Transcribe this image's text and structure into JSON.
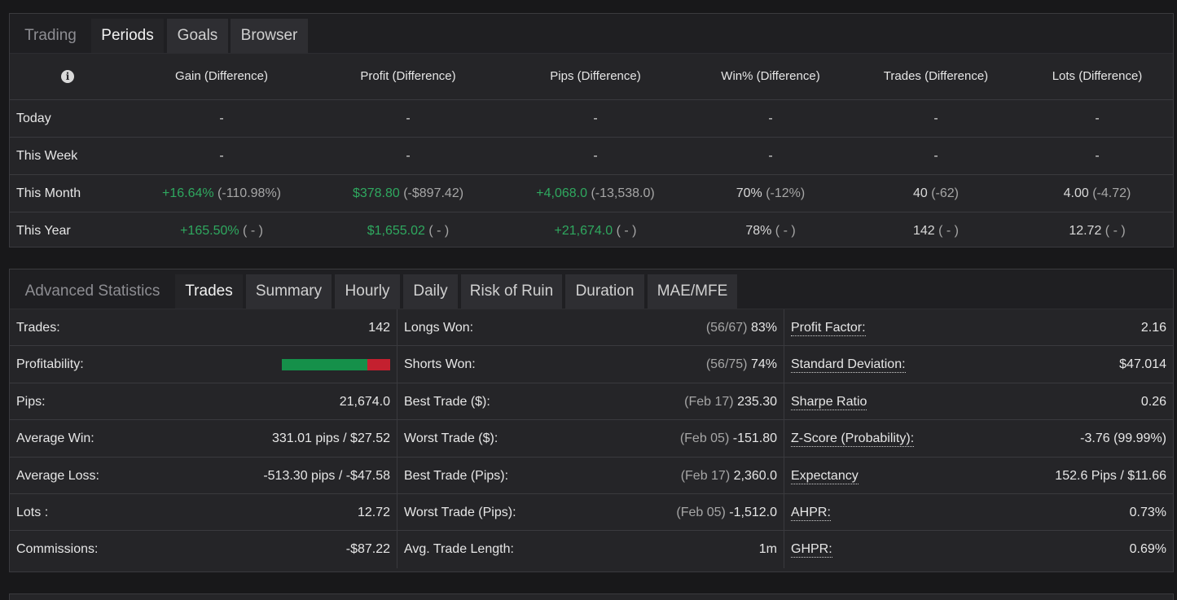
{
  "periods_tabs": [
    "Trading",
    "Periods",
    "Goals",
    "Browser"
  ],
  "periods": {
    "headers": [
      "Gain (Difference)",
      "Profit (Difference)",
      "Pips (Difference)",
      "Win% (Difference)",
      "Trades (Difference)",
      "Lots (Difference)"
    ],
    "rows": [
      {
        "label": "Today",
        "cells": [
          [
            "-",
            ""
          ],
          [
            "-",
            ""
          ],
          [
            "-",
            ""
          ],
          [
            "-",
            ""
          ],
          [
            "-",
            ""
          ],
          [
            "-",
            ""
          ]
        ]
      },
      {
        "label": "This Week",
        "cells": [
          [
            "-",
            ""
          ],
          [
            "-",
            ""
          ],
          [
            "-",
            ""
          ],
          [
            "-",
            ""
          ],
          [
            "-",
            ""
          ],
          [
            "-",
            ""
          ]
        ]
      },
      {
        "label": "This Month",
        "cells": [
          [
            "+16.64%",
            " (-110.98%)"
          ],
          [
            "$378.80",
            " (-$897.42)"
          ],
          [
            "+4,068.0",
            " (-13,538.0)"
          ],
          [
            "70%",
            " (-12%)"
          ],
          [
            "40",
            " (-62)"
          ],
          [
            "4.00",
            " (-4.72)"
          ]
        ]
      },
      {
        "label": "This Year",
        "cells": [
          [
            "+165.50%",
            " ( - )"
          ],
          [
            "$1,655.02",
            " ( - )"
          ],
          [
            "+21,674.0",
            " ( - )"
          ],
          [
            "78%",
            " ( - )"
          ],
          [
            "142",
            " ( - )"
          ],
          [
            "12.72",
            " ( - )"
          ]
        ]
      }
    ]
  },
  "adv_tabs": [
    "Advanced Statistics",
    "Trades",
    "Summary",
    "Hourly",
    "Daily",
    "Risk of Ruin",
    "Duration",
    "MAE/MFE"
  ],
  "adv": {
    "col1": [
      {
        "k": "Trades:",
        "v": "142"
      },
      {
        "k": "Profitability:",
        "v": ""
      },
      {
        "k": "Pips:",
        "v": "21,674.0"
      },
      {
        "k": "Average Win:",
        "v": "331.01 pips / $27.52"
      },
      {
        "k": "Average Loss:",
        "v": "-513.30 pips / -$47.58"
      },
      {
        "k": "Lots :",
        "v": "12.72"
      },
      {
        "k": "Commissions:",
        "v": "-$87.22"
      }
    ],
    "profitability_win_fraction": 0.79,
    "col2": [
      {
        "k": "Longs Won:",
        "m": "(56/67)",
        "v": "83%"
      },
      {
        "k": "Shorts Won:",
        "m": "(56/75)",
        "v": "74%"
      },
      {
        "k": "Best Trade ($):",
        "m": "(Feb 17)",
        "v": "235.30"
      },
      {
        "k": "Worst Trade ($):",
        "m": "(Feb 05)",
        "v": "-151.80"
      },
      {
        "k": "Best Trade (Pips):",
        "m": "(Feb 17)",
        "v": "2,360.0"
      },
      {
        "k": "Worst Trade (Pips):",
        "m": "(Feb 05)",
        "v": "-1,512.0"
      },
      {
        "k": "Avg. Trade Length:",
        "m": "",
        "v": "1m"
      }
    ],
    "col3": [
      {
        "k": "Profit Factor:",
        "v": "2.16"
      },
      {
        "k": "Standard Deviation:",
        "v": "$47.014"
      },
      {
        "k": "Sharpe Ratio",
        "v": "0.26"
      },
      {
        "k": "Z-Score (Probability):",
        "v": "-3.76 (99.99%)"
      },
      {
        "k": "Expectancy",
        "v": "152.6 Pips / $11.66"
      },
      {
        "k": "AHPR:",
        "v": "0.73%"
      },
      {
        "k": "GHPR:",
        "v": "0.69%"
      }
    ]
  },
  "colors": {
    "positive": "#2fa85f",
    "negative": "#c4202f",
    "win_bar": "#15904a"
  },
  "icons": {
    "info": "info-icon"
  }
}
